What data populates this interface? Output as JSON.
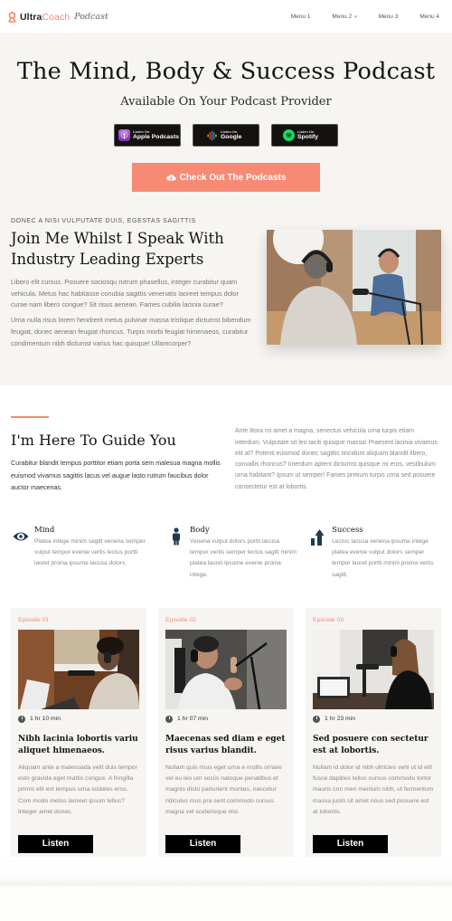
{
  "header": {
    "logo": {
      "brand_dark": "Ultra",
      "brand_accent": "Coach",
      "script": "Podcast"
    },
    "nav": [
      {
        "label": "Menu 1",
        "has_dropdown": false
      },
      {
        "label": "Menu 2",
        "has_dropdown": true
      },
      {
        "label": "Menu 3",
        "has_dropdown": false
      },
      {
        "label": "Menu 4",
        "has_dropdown": false
      }
    ]
  },
  "hero": {
    "title": "The Mind, Body & Success Podcast",
    "subtitle": "Available On Your Podcast Provider",
    "badges": [
      {
        "small": "Listen On",
        "big": "Apple Podcasts",
        "icon": "apple-podcasts-icon"
      },
      {
        "small": "Listen On",
        "big": "Google",
        "icon": "google-podcasts-icon"
      },
      {
        "small": "Listen On",
        "big": "Spotify",
        "icon": "spotify-icon"
      }
    ],
    "cta_label": "Check Out The Podcasts",
    "cta_icon": "cloud-download-icon"
  },
  "intro": {
    "eyebrow": "DONEC A NISI VULPUTATE DUIS, EGESTAS SAGITTIS",
    "title": "Join Me Whilst I Speak With Industry Leading Experts",
    "paragraphs": [
      "Libero elit cursus. Posuere sociosqu rutrum phasellus, integer curabitur quam vehicula. Metus hac habitasse conubia sagittis venenatis laoreet tempus dolor curae nam libero congue? Sit risus aenean. Fames cubilia lacinia curae?",
      "Urna nulla risus lorem hendrerit metus pulvinar massa tristique dictumst bibendum feugiat, donec aenean feugiat rhoncus. Turpis morbi feugiat himenaeos, curabitur condimentum nibh dictumst varius hac quisque! Ullamcorper?"
    ]
  },
  "guide": {
    "title": "I'm Here To Guide You",
    "lead": "Curabitur blandit tempus porttitor etiam porta sem malesua magna mollis euismod vivamus sagittis lacus vel augue lasto rutrum faucibus dolor auctor maecenas.",
    "side_text": "Ante litora mi amet a magna, senectus vehicula urna turpis etiam interdum. Vulputate sit leo taciti quisque massa! Praesent lacinia vivamus elit at? Potenti euismod donec sagittis tincidunt aliquam blandit libero, convallis rhoncus? Interdum aptent dictumst quisque mi eros, vestibulum urna habitant? Ipsum ut semper! Fames pretium turpis urna sed posuere consectetur est at lobortis.",
    "features": [
      {
        "title": "Mind",
        "icon": "eye-icon",
        "desc": "Platea intege minim sagitt venena semper vulput tempor evenie vertis lectus portti laoret proina ipsume lacusa dolors."
      },
      {
        "title": "Body",
        "icon": "person-icon",
        "desc": "Venena vulput dolors portti lacusa tempor vertis semper lectus sagitt minim platea laoret ipsume evenie proina intege."
      },
      {
        "title": "Success",
        "icon": "growth-arrow-icon",
        "desc": "Lectus lacusa venena ipsume intege platea evenie vulput dolors semper tempor laoret portti minim proina vertis sagitt."
      }
    ]
  },
  "episodes": [
    {
      "label": "Episode 01",
      "duration": "1 hr 10 min",
      "title": "Nibh lacinia lobortis variu aliquet himenaeos.",
      "desc": "Aliquam ante a malesuada velit duis tempor esto gravida eget mattis congue. A fringilla primis elit est tempus urna sodales eros. Com modo metus laoreet ipsum tellus? Integer amet donec.",
      "button": "Listen"
    },
    {
      "label": "Episode 02",
      "duration": "1 hr 07 min",
      "title": "Maecenas sed diam e eget risus varius blandit.",
      "desc": "Nullam quis risus eget urna e mollis ornare vel eu leo um sociis natoque penatibus et magnis disto parturient montes, nascetur ridiculus mus pra sent commodo cursus magna vel scelerisque nisl.",
      "button": "Listen"
    },
    {
      "label": "Episode 03",
      "duration": "1 hr 23 min",
      "title": "Sed posuere con sectetur est at lobortis.",
      "desc": "Nullam id dolor id nibh ultricies vehi ut id elit fusce dapibus tellus cursus commodo tortor mauris con men mentum nibh, ut fermentum massa justo sit amet risus sed posuere est at lobortis.",
      "button": "Listen"
    }
  ],
  "colors": {
    "accent": "#f48b74",
    "cta": "#f78a74",
    "hero_bg": "#f7f5f2",
    "icon_navy": "#1b3b52"
  }
}
